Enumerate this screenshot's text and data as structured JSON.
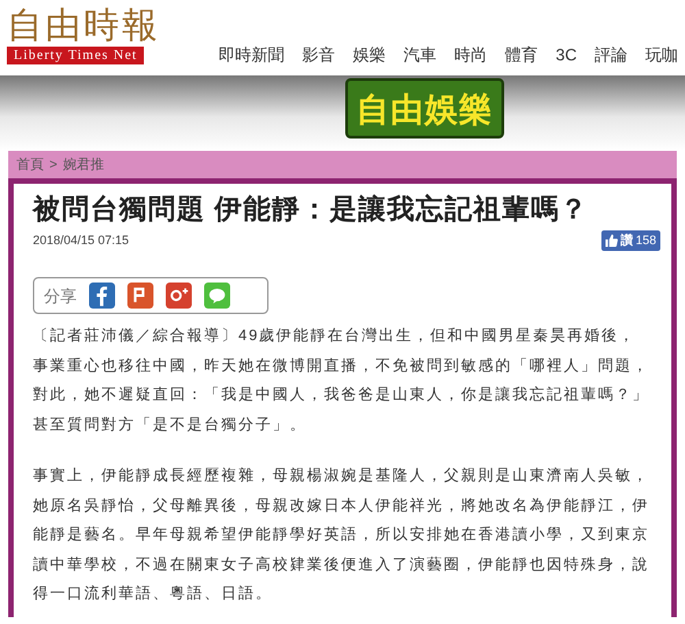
{
  "header": {
    "logo_title": "自由時報",
    "logo_subtitle": "Liberty Times Net",
    "nav": [
      "即時新聞",
      "影音",
      "娛樂",
      "汽車",
      "時尚",
      "體育",
      "3C",
      "評論",
      "玩咖"
    ]
  },
  "banner": {
    "logo": "自由娛樂"
  },
  "breadcrumb": [
    {
      "label": "首頁"
    },
    {
      "label": ">"
    },
    {
      "label": "婉君推"
    }
  ],
  "article": {
    "title": "被問台獨問題 伊能靜：是讓我忘記祖輩嗎？",
    "date": "2018/04/15 07:15",
    "like": {
      "label": "讚",
      "count": "158"
    },
    "share": {
      "label": "分享",
      "buttons": [
        {
          "kind": "facebook"
        },
        {
          "kind": "plurk"
        },
        {
          "kind": "googleplus"
        },
        {
          "kind": "line"
        }
      ]
    },
    "paragraphs": [
      "〔記者莊沛儀／綜合報導〕49歲伊能靜在台灣出生，但和中國男星秦昊再婚後，事業重心也移往中國，昨天她在微博開直播，不免被問到敏感的「哪裡人」問題，對此，她不遲疑直回：「我是中國人，我爸爸是山東人，你是讓我忘記祖輩嗎？」甚至質問對方「是不是台獨分子」。",
      "事實上，伊能靜成長經歷複雜，母親楊淑婉是基隆人，父親則是山東濟南人吳敏，她原名吳靜怡，父母離異後，母親改嫁日本人伊能祥光，將她改名為伊能靜江，伊能靜是藝名。早年母親希望伊能靜學好英語，所以安排她在香港讀小學，又到東京讀中華學校，不過在關東女子高校肄業後便進入了演藝圈，伊能靜也因特殊身，說得一口流利華語、粵語、日語。"
    ]
  }
}
